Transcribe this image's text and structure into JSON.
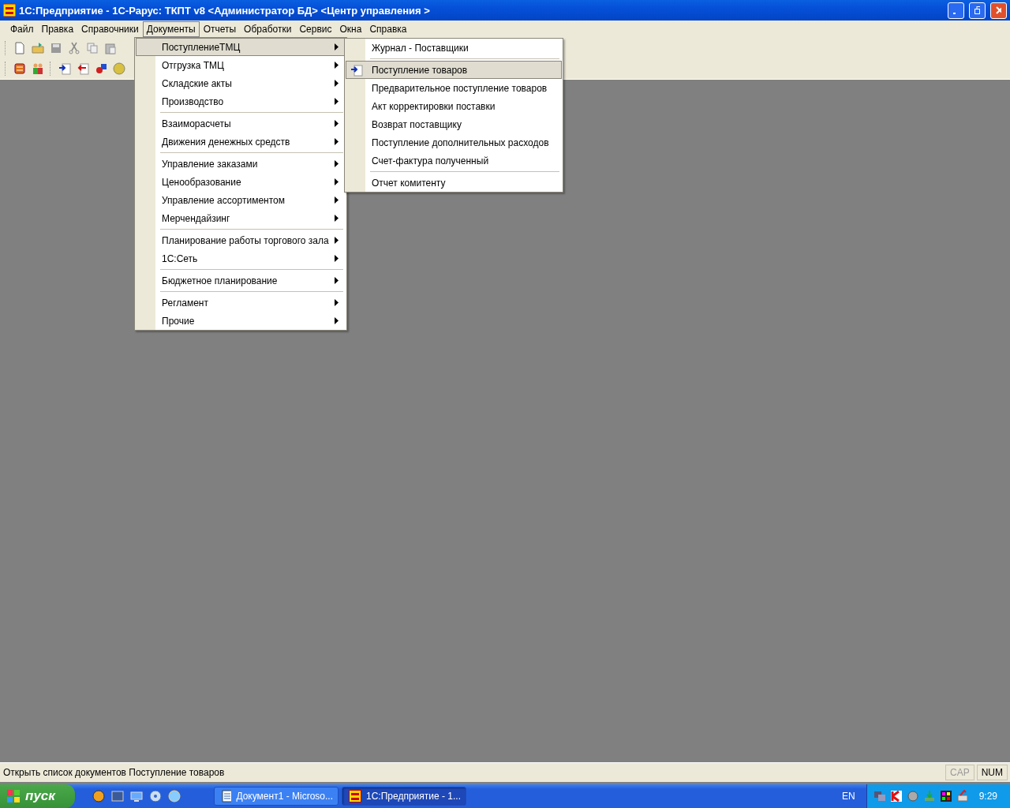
{
  "window": {
    "title": "1С:Предприятие - 1С-Рарус: ТКПТ v8 <Администратор БД> <Центр управления >"
  },
  "menu_bar": [
    {
      "label": "Файл",
      "selected": false
    },
    {
      "label": "Правка",
      "selected": false
    },
    {
      "label": "Справочники",
      "selected": false
    },
    {
      "label": "Документы",
      "selected": true
    },
    {
      "label": "Отчеты",
      "selected": false
    },
    {
      "label": "Обработки",
      "selected": false
    },
    {
      "label": "Сервис",
      "selected": false
    },
    {
      "label": "Окна",
      "selected": false
    },
    {
      "label": "Справка",
      "selected": false
    }
  ],
  "documents_menu": {
    "groups": [
      [
        {
          "label": "ПоступлениеТМЦ",
          "selected": true
        },
        {
          "label": "Отгрузка ТМЦ",
          "selected": false
        },
        {
          "label": "Складские акты",
          "selected": false
        },
        {
          "label": "Производство",
          "selected": false
        }
      ],
      [
        {
          "label": "Взаиморасчеты",
          "selected": false
        },
        {
          "label": "Движения денежных средств",
          "selected": false
        }
      ],
      [
        {
          "label": "Управление заказами",
          "selected": false
        },
        {
          "label": "Ценообразование",
          "selected": false
        },
        {
          "label": "Управление ассортиментом",
          "selected": false
        },
        {
          "label": "Мерчендайзинг",
          "selected": false
        }
      ],
      [
        {
          "label": "Планирование работы торгового зала",
          "selected": false
        },
        {
          "label": "1С:Сеть",
          "selected": false
        }
      ],
      [
        {
          "label": "Бюджетное планирование",
          "selected": false
        }
      ],
      [
        {
          "label": "Регламент",
          "selected": false
        },
        {
          "label": "Прочие",
          "selected": false
        }
      ]
    ]
  },
  "submenu": {
    "groups": [
      [
        {
          "label": "Журнал - Поставщики",
          "selected": false,
          "has_icon": false
        }
      ],
      [
        {
          "label": "Поступление товаров",
          "selected": true,
          "has_icon": true
        },
        {
          "label": "Предварительное поступление товаров",
          "selected": false,
          "has_icon": false
        },
        {
          "label": "Акт корректировки поставки",
          "selected": false,
          "has_icon": false
        },
        {
          "label": "Возврат поставщику",
          "selected": false,
          "has_icon": false
        },
        {
          "label": "Поступление дополнительных расходов",
          "selected": false,
          "has_icon": false
        },
        {
          "label": "Счет-фактура полученный",
          "selected": false,
          "has_icon": false
        }
      ],
      [
        {
          "label": "Отчет комитенту",
          "selected": false,
          "has_icon": false
        }
      ]
    ]
  },
  "status_bar": {
    "message": "Открыть список документов Поступление товаров",
    "indicators": [
      {
        "label": "CAP",
        "on": false
      },
      {
        "label": "NUM",
        "on": true
      }
    ]
  },
  "taskbar": {
    "start": "пуск",
    "tasks": [
      {
        "label": "Документ1 - Microso...",
        "selected": false,
        "kind": "word"
      },
      {
        "label": "1С:Предприятие - 1...",
        "selected": true,
        "kind": "onec"
      }
    ],
    "language": "EN",
    "clock": "9:29"
  }
}
